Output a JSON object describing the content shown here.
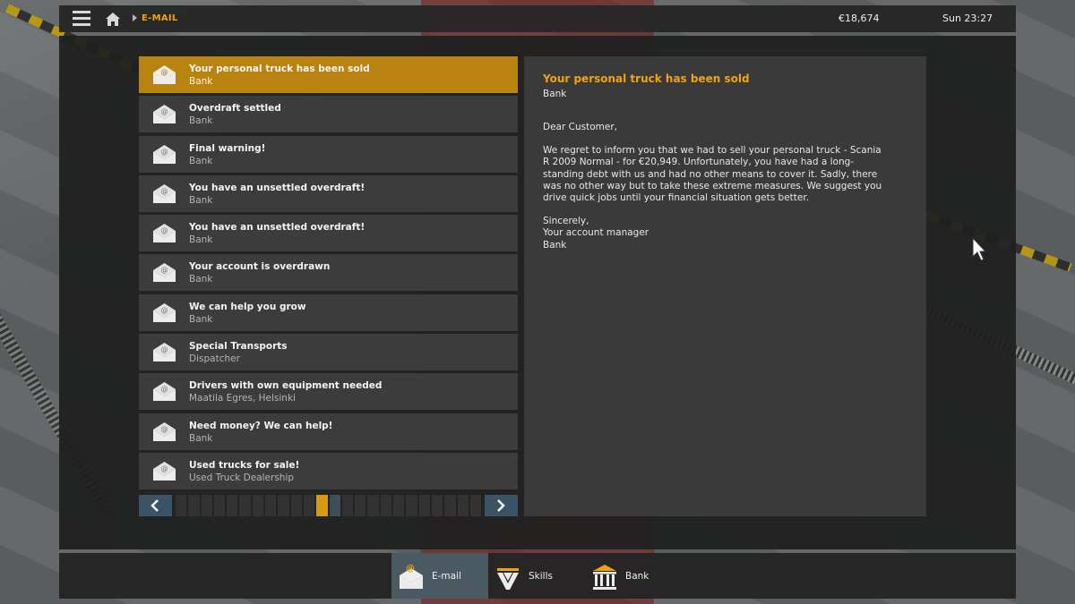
{
  "topbar": {
    "breadcrumb": "E-MAIL",
    "money": "€18,674",
    "clock": "Sun 23:27",
    "icons": [
      "menu-icon",
      "home-icon"
    ]
  },
  "mail_list": [
    {
      "subject": "Your personal truck has been sold",
      "from": "Bank",
      "selected": true
    },
    {
      "subject": "Overdraft settled",
      "from": "Bank"
    },
    {
      "subject": "Final warning!",
      "from": "Bank"
    },
    {
      "subject": "You have an unsettled overdraft!",
      "from": "Bank"
    },
    {
      "subject": "You have an unsettled overdraft!",
      "from": "Bank"
    },
    {
      "subject": "Your account is overdrawn",
      "from": "Bank"
    },
    {
      "subject": "We can help you grow",
      "from": "Bank"
    },
    {
      "subject": "Special Transports",
      "from": "Dispatcher"
    },
    {
      "subject": "Drivers with own equipment needed",
      "from": "Maatila Egres, Helsinki"
    },
    {
      "subject": "Need money? We can help!",
      "from": "Bank"
    },
    {
      "subject": "Used trucks for sale!",
      "from": "Used Truck Dealership"
    }
  ],
  "pager": {
    "current_page": 12,
    "hover_page": 13,
    "page_count": 24
  },
  "reader": {
    "subject": "Your personal truck has been sold",
    "from": "Bank",
    "greeting": "Dear Customer,",
    "body": "We regret to inform you that we had to sell your personal truck - Scania R 2009 Normal - for €20,949. Unfortunately, you have had a long-standing debt with us and had no other means to cover it. Sadly, there was no other way but to take these extreme measures. We suggest you drive quick jobs until your financial situation gets better.",
    "closing": "Sincerely,",
    "signature1": "Your account manager",
    "signature2": "Bank"
  },
  "tabs": [
    {
      "label": "E-mail",
      "icon": "email-icon",
      "active": true
    },
    {
      "label": "Skills",
      "icon": "skills-icon",
      "active": false
    },
    {
      "label": "Bank",
      "icon": "bank-icon",
      "active": false
    }
  ],
  "colors": {
    "accent": "#f0a30a",
    "selected_row": "#b9830f",
    "active_tab": "#4b5963",
    "panel": "#202020"
  }
}
